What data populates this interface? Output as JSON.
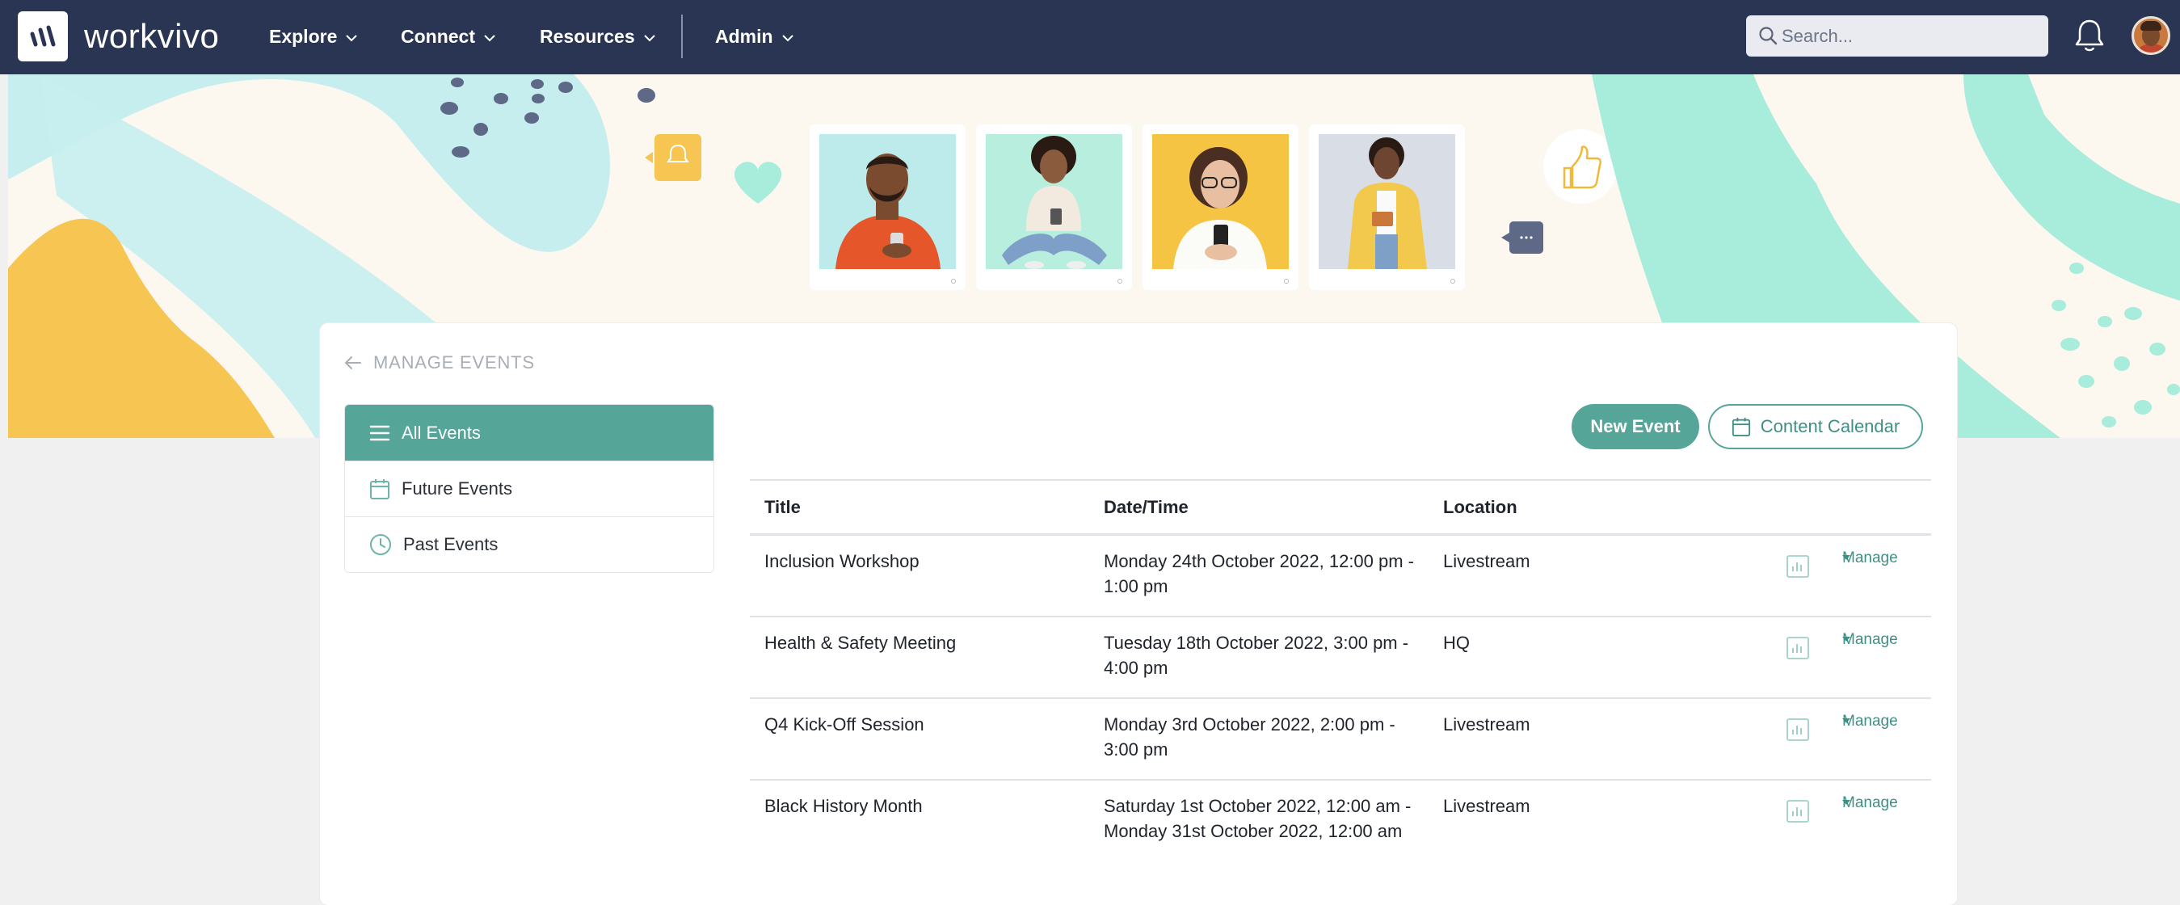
{
  "nav": {
    "brand": "workvivo",
    "items": [
      {
        "label": "Explore"
      },
      {
        "label": "Connect"
      },
      {
        "label": "Resources"
      },
      {
        "label": "Admin"
      }
    ],
    "search_placeholder": "Search..."
  },
  "page": {
    "back_label": "MANAGE EVENTS",
    "sidebar": [
      {
        "label": "All Events",
        "icon": "list-icon",
        "active": true
      },
      {
        "label": "Future Events",
        "icon": "calendar-icon",
        "active": false
      },
      {
        "label": "Past Events",
        "icon": "clock-icon",
        "active": false
      }
    ],
    "new_event_label": "New Event",
    "content_calendar_label": "Content Calendar"
  },
  "table": {
    "headers": {
      "title": "Title",
      "datetime": "Date/Time",
      "location": "Location"
    },
    "manage_label": "Manage",
    "rows": [
      {
        "title": "Inclusion Workshop",
        "datetime": "Monday 24th October 2022, 12:00 pm - 1:00 pm",
        "location": "Livestream"
      },
      {
        "title": "Health & Safety Meeting",
        "datetime": "Tuesday 18th October 2022, 3:00 pm - 4:00 pm",
        "location": "HQ"
      },
      {
        "title": "Q4 Kick-Off Session",
        "datetime": "Monday 3rd October 2022, 2:00 pm - 3:00 pm",
        "location": "Livestream"
      },
      {
        "title": "Black History Month",
        "datetime": "Saturday 1st October 2022, 12:00 am - Monday 31st October 2022, 12:00 am",
        "location": "Livestream"
      }
    ]
  },
  "colors": {
    "nav_bg": "#293553",
    "accent": "#56a599",
    "banner_bg": "#fcf7ef"
  }
}
